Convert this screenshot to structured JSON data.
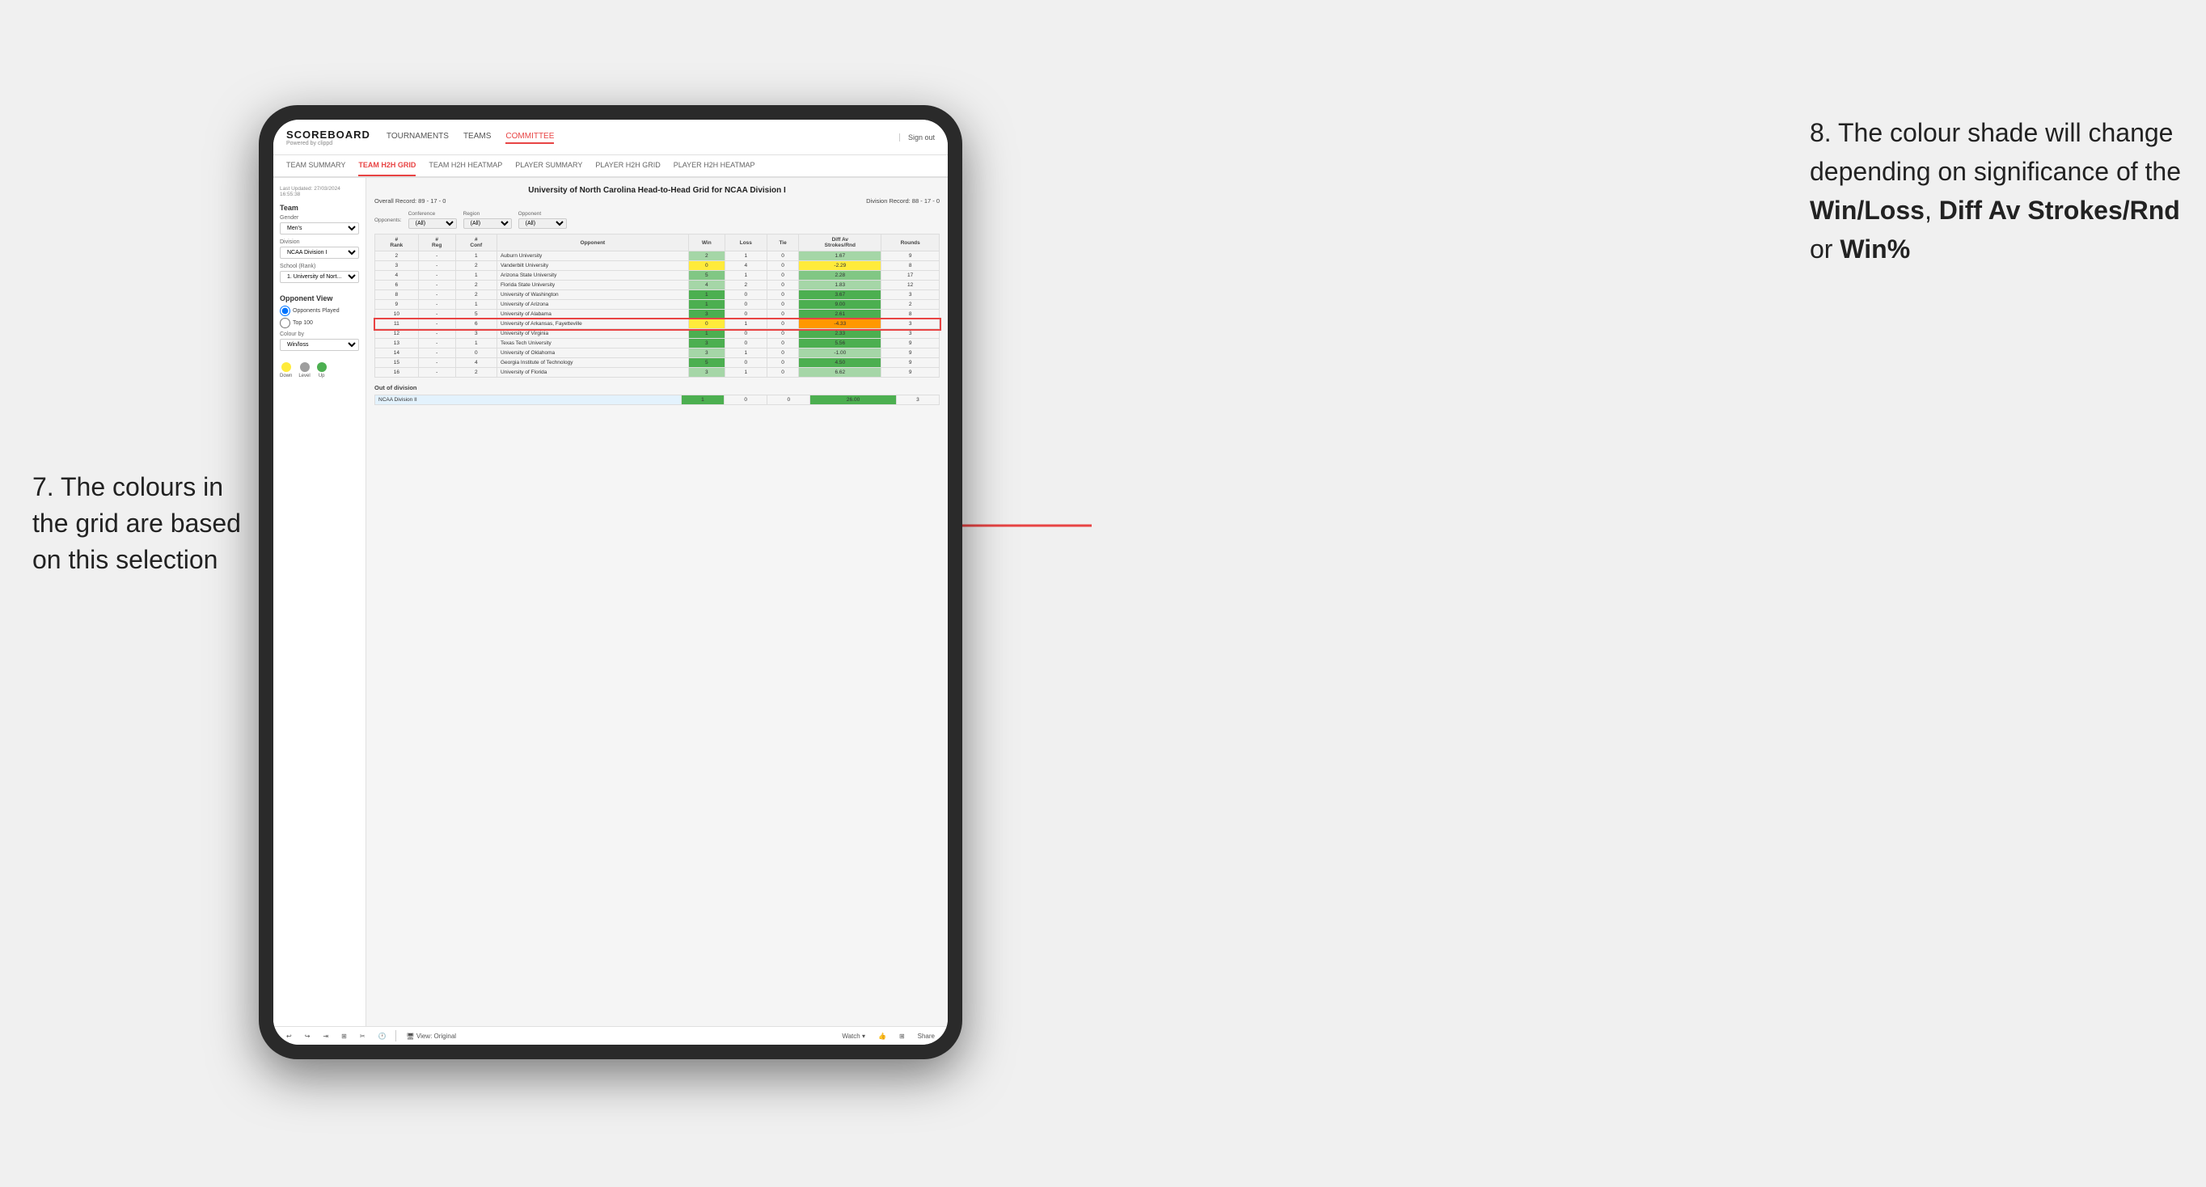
{
  "annotations": {
    "left": {
      "text": "7. The colours in the grid are based on this selection"
    },
    "right": {
      "line1": "8. The colour shade will change depending on significance of the ",
      "bold1": "Win/Loss",
      "line2": ", ",
      "bold2": "Diff Av Strokes/Rnd",
      "line3": " or ",
      "bold3": "Win%"
    }
  },
  "nav": {
    "logo": "SCOREBOARD",
    "logo_sub": "Powered by clippd",
    "links": [
      "TOURNAMENTS",
      "TEAMS",
      "COMMITTEE"
    ],
    "sign_out": "Sign out"
  },
  "sub_nav": {
    "items": [
      "TEAM SUMMARY",
      "TEAM H2H GRID",
      "TEAM H2H HEATMAP",
      "PLAYER SUMMARY",
      "PLAYER H2H GRID",
      "PLAYER H2H HEATMAP"
    ],
    "active": "TEAM H2H GRID"
  },
  "left_panel": {
    "timestamp": "Last Updated: 27/03/2024\n16:55:38",
    "section_team": "Team",
    "gender_label": "Gender",
    "gender_value": "Men's",
    "division_label": "Division",
    "division_value": "NCAA Division I",
    "school_label": "School (Rank)",
    "school_value": "1. University of Nort...",
    "opponent_view_label": "Opponent View",
    "radio_opponents": "Opponents Played",
    "radio_top100": "Top 100",
    "colour_by_label": "Colour by",
    "colour_by_value": "Win/loss",
    "legend": {
      "down": "Down",
      "level": "Level",
      "up": "Up"
    }
  },
  "grid": {
    "title": "University of North Carolina Head-to-Head Grid for NCAA Division I",
    "overall_record": "Overall Record: 89 - 17 - 0",
    "division_record": "Division Record: 88 - 17 - 0",
    "filters": {
      "opponents_label": "Opponents:",
      "conference_label": "Conference",
      "conference_value": "(All)",
      "region_label": "Region",
      "region_value": "(All)",
      "opponent_label": "Opponent",
      "opponent_value": "(All)"
    },
    "columns": [
      "#\nRank",
      "#\nReg",
      "#\nConf",
      "Opponent",
      "Win",
      "Loss",
      "Tie",
      "Diff Av\nStrokes/Rnd",
      "Rounds"
    ],
    "rows": [
      {
        "rank": "2",
        "reg": "-",
        "conf": "1",
        "opponent": "Auburn University",
        "win": "2",
        "loss": "1",
        "tie": "0",
        "diff": "1.67",
        "rounds": "9",
        "win_color": "green_light",
        "diff_color": "green_light"
      },
      {
        "rank": "3",
        "reg": "-",
        "conf": "2",
        "opponent": "Vanderbilt University",
        "win": "0",
        "loss": "4",
        "tie": "0",
        "diff": "-2.29",
        "rounds": "8",
        "win_color": "yellow",
        "diff_color": "yellow"
      },
      {
        "rank": "4",
        "reg": "-",
        "conf": "1",
        "opponent": "Arizona State University",
        "win": "5",
        "loss": "1",
        "tie": "0",
        "diff": "2.28",
        "rounds": "17",
        "win_color": "green_mid",
        "diff_color": "green_mid"
      },
      {
        "rank": "6",
        "reg": "-",
        "conf": "2",
        "opponent": "Florida State University",
        "win": "4",
        "loss": "2",
        "tie": "0",
        "diff": "1.83",
        "rounds": "12",
        "win_color": "green_light",
        "diff_color": "green_light"
      },
      {
        "rank": "8",
        "reg": "-",
        "conf": "2",
        "opponent": "University of Washington",
        "win": "1",
        "loss": "0",
        "tie": "0",
        "diff": "3.67",
        "rounds": "3",
        "win_color": "green_dark",
        "diff_color": "green_dark"
      },
      {
        "rank": "9",
        "reg": "-",
        "conf": "1",
        "opponent": "University of Arizona",
        "win": "1",
        "loss": "0",
        "tie": "0",
        "diff": "9.00",
        "rounds": "2",
        "win_color": "green_dark",
        "diff_color": "green_dark"
      },
      {
        "rank": "10",
        "reg": "-",
        "conf": "5",
        "opponent": "University of Alabama",
        "win": "3",
        "loss": "0",
        "tie": "0",
        "diff": "2.61",
        "rounds": "8",
        "win_color": "green_dark",
        "diff_color": "green_dark"
      },
      {
        "rank": "11",
        "reg": "-",
        "conf": "6",
        "opponent": "University of Arkansas, Fayetteville",
        "win": "0",
        "loss": "1",
        "tie": "0",
        "diff": "-4.33",
        "rounds": "3",
        "win_color": "yellow",
        "diff_color": "orange"
      },
      {
        "rank": "12",
        "reg": "-",
        "conf": "3",
        "opponent": "University of Virginia",
        "win": "1",
        "loss": "0",
        "tie": "0",
        "diff": "2.33",
        "rounds": "3",
        "win_color": "green_dark",
        "diff_color": "green_dark"
      },
      {
        "rank": "13",
        "reg": "-",
        "conf": "1",
        "opponent": "Texas Tech University",
        "win": "3",
        "loss": "0",
        "tie": "0",
        "diff": "5.56",
        "rounds": "9",
        "win_color": "green_dark",
        "diff_color": "green_dark"
      },
      {
        "rank": "14",
        "reg": "-",
        "conf": "0",
        "opponent": "University of Oklahoma",
        "win": "3",
        "loss": "1",
        "tie": "0",
        "diff": "-1.00",
        "rounds": "9",
        "win_color": "green_light",
        "diff_color": "green_light"
      },
      {
        "rank": "15",
        "reg": "-",
        "conf": "4",
        "opponent": "Georgia Institute of Technology",
        "win": "5",
        "loss": "0",
        "tie": "0",
        "diff": "4.50",
        "rounds": "9",
        "win_color": "green_dark",
        "diff_color": "green_dark"
      },
      {
        "rank": "16",
        "reg": "-",
        "conf": "2",
        "opponent": "University of Florida",
        "win": "3",
        "loss": "1",
        "tie": "0",
        "diff": "6.62",
        "rounds": "9",
        "win_color": "green_light",
        "diff_color": "green_light"
      }
    ],
    "out_of_division": {
      "title": "Out of division",
      "rows": [
        {
          "division": "NCAA Division II",
          "win": "1",
          "loss": "0",
          "tie": "0",
          "diff": "26.00",
          "rounds": "3",
          "win_color": "green_dark",
          "diff_color": "green_dark"
        }
      ]
    }
  },
  "toolbar": {
    "view_label": "View: Original",
    "watch_label": "Watch ▾",
    "share_label": "Share"
  }
}
